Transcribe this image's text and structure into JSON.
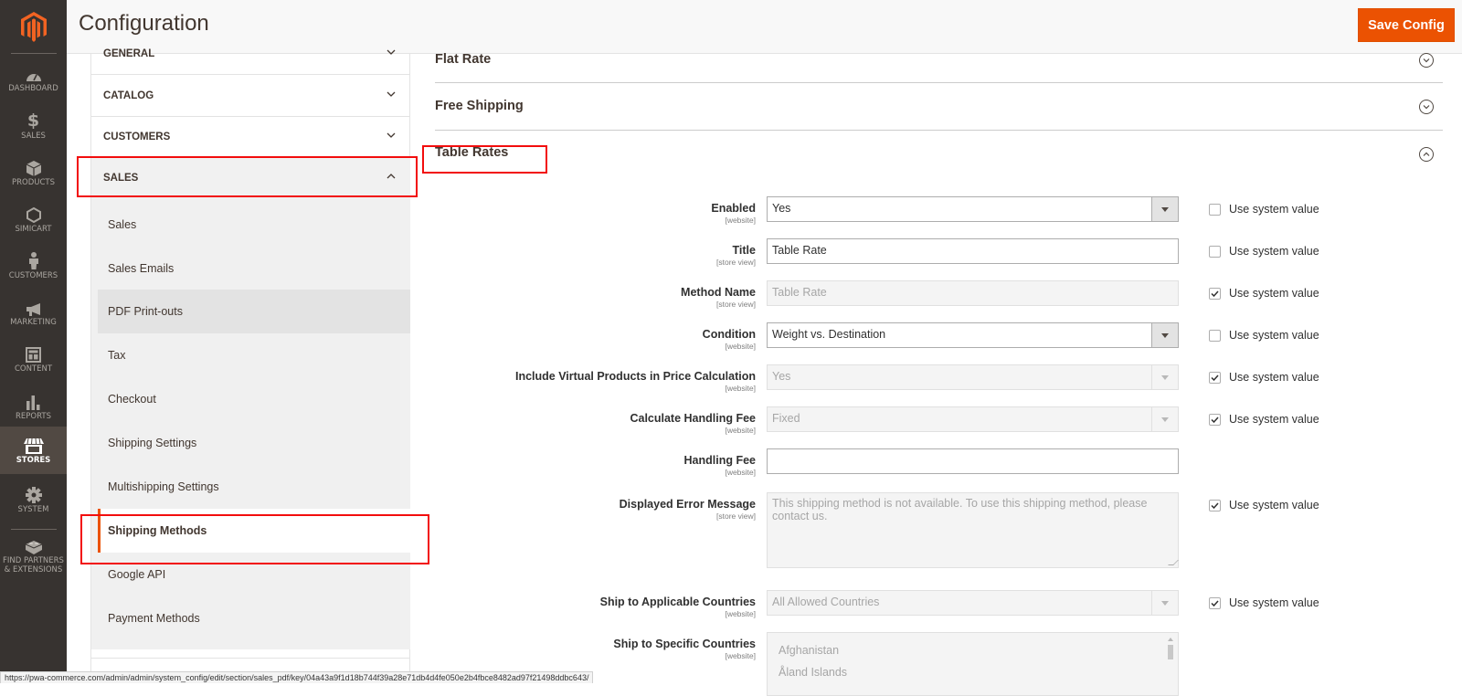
{
  "app": {
    "page_title": "Configuration",
    "save_button": "Save Config",
    "brand_color": "#eb5202"
  },
  "nav": {
    "logo": "magento-logo-icon",
    "items": [
      {
        "label": "DASHBOARD",
        "icon": "dashboard-icon"
      },
      {
        "label": "SALES",
        "icon": "dollar-icon"
      },
      {
        "label": "PRODUCTS",
        "icon": "box-icon"
      },
      {
        "label": "SIMICART",
        "icon": "hexagon-icon"
      },
      {
        "label": "CUSTOMERS",
        "icon": "person-icon"
      },
      {
        "label": "MARKETING",
        "icon": "megaphone-icon"
      },
      {
        "label": "CONTENT",
        "icon": "layout-icon"
      },
      {
        "label": "REPORTS",
        "icon": "bar-chart-icon"
      },
      {
        "label": "STORES",
        "icon": "storefront-icon",
        "active": true
      },
      {
        "label": "SYSTEM",
        "icon": "gear-icon"
      },
      {
        "label_line1": "FIND PARTNERS",
        "label_line2": "& EXTENSIONS",
        "icon": "brick-icon"
      }
    ]
  },
  "config_tabs": {
    "groups": [
      {
        "label": "GENERAL",
        "state": "collapsed"
      },
      {
        "label": "CATALOG",
        "state": "collapsed"
      },
      {
        "label": "CUSTOMERS",
        "state": "collapsed"
      },
      {
        "label": "SALES",
        "state": "expanded"
      }
    ],
    "sales_items": [
      {
        "label": "Sales"
      },
      {
        "label": "Sales Emails"
      },
      {
        "label": "PDF Print-outs",
        "state": "hover"
      },
      {
        "label": "Tax"
      },
      {
        "label": "Checkout"
      },
      {
        "label": "Shipping Settings"
      },
      {
        "label": "Multishipping Settings"
      },
      {
        "label": "Shipping Methods",
        "state": "current"
      },
      {
        "label": "Google API"
      },
      {
        "label": "Payment Methods"
      }
    ]
  },
  "sections": [
    {
      "title": "Flat Rate",
      "state": "collapsed"
    },
    {
      "title": "Free Shipping",
      "state": "collapsed"
    },
    {
      "title": "Table Rates",
      "state": "expanded"
    }
  ],
  "use_system_value_label": "Use system value",
  "fields": [
    {
      "label": "Enabled",
      "scope": "[website]",
      "type": "select",
      "value": "Yes",
      "disabled": false,
      "use_system": false
    },
    {
      "label": "Title",
      "scope": "[store view]",
      "type": "text",
      "value": "Table Rate",
      "disabled": false,
      "use_system": false
    },
    {
      "label": "Method Name",
      "scope": "[store view]",
      "type": "text",
      "value": "Table Rate",
      "disabled": true,
      "use_system": true
    },
    {
      "label": "Condition",
      "scope": "[website]",
      "type": "select",
      "value": "Weight vs. Destination",
      "disabled": false,
      "use_system": false
    },
    {
      "label": "Include Virtual Products in Price Calculation",
      "scope": "[website]",
      "type": "select",
      "value": "Yes",
      "disabled": true,
      "use_system": true
    },
    {
      "label": "Calculate Handling Fee",
      "scope": "[website]",
      "type": "select",
      "value": "Fixed",
      "disabled": true,
      "use_system": true
    },
    {
      "label": "Handling Fee",
      "scope": "[website]",
      "type": "text",
      "value": "",
      "disabled": false
    },
    {
      "label": "Displayed Error Message",
      "scope": "[store view]",
      "type": "textarea",
      "value": "This shipping method is not available. To use this shipping method, please contact us.",
      "disabled": true,
      "use_system": true
    },
    {
      "label": "Ship to Applicable Countries",
      "scope": "[website]",
      "type": "select",
      "value": "All Allowed Countries",
      "disabled": true,
      "use_system": true
    },
    {
      "label": "Ship to Specific Countries",
      "scope": "[website]",
      "type": "multiselect",
      "options": [
        "Afghanistan",
        "Åland Islands"
      ],
      "disabled": true
    }
  ],
  "status_bar": {
    "url": "https://pwa-commerce.com/admin/admin/system_config/edit/section/sales_pdf/key/04a43a9f1d18b744f39a28e71db4d4fe050e2b4fbce8482ad97f21498ddbc643/"
  }
}
